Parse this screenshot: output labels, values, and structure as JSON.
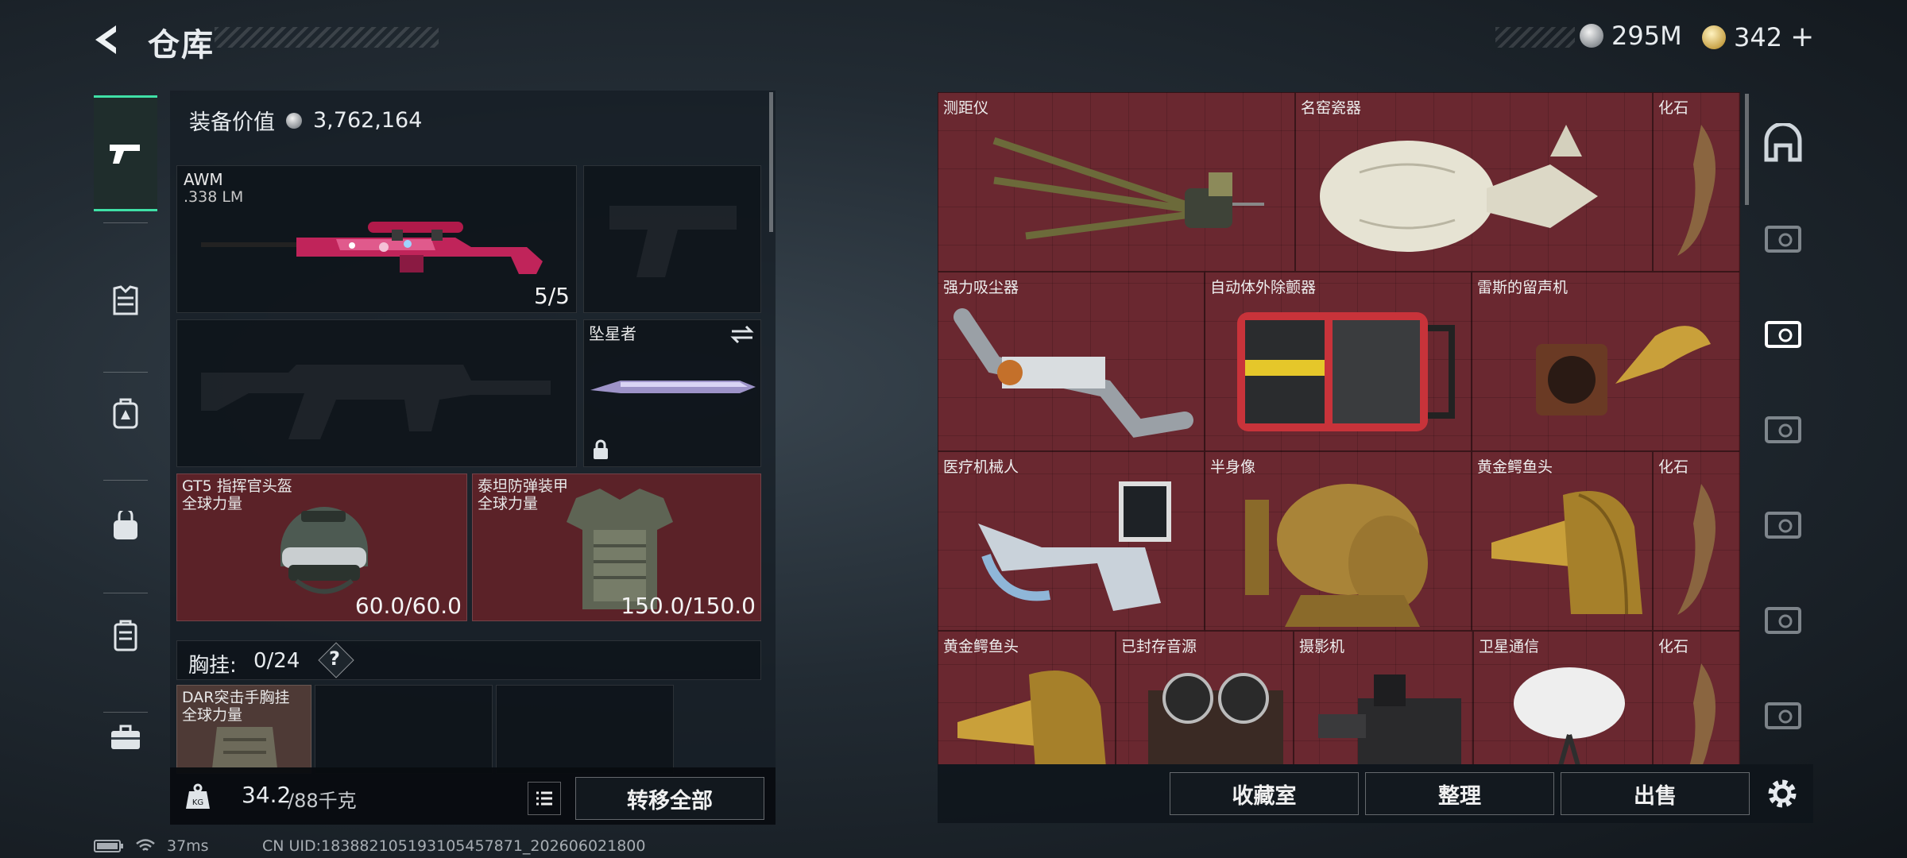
{
  "header": {
    "title": "仓库",
    "silver": "295M",
    "gold": "342",
    "plus": "+"
  },
  "equip": {
    "value_label": "装备价值",
    "value": "3,762,164"
  },
  "primary": {
    "name": "AWM",
    "ammo": ".338 LM",
    "count": "5/5"
  },
  "melee": {
    "name": "坠星者"
  },
  "helmet": {
    "name": "GT5 指挥官头盔",
    "maker": "全球力量",
    "durability": "60.0/60.0"
  },
  "armor": {
    "name": "泰坦防弹装甲",
    "maker": "全球力量",
    "durability": "150.0/150.0"
  },
  "rig": {
    "label": "胸挂:",
    "slots": "0/24",
    "help": "?",
    "item_name": "DAR突击手胸挂",
    "item_maker": "全球力量"
  },
  "weight": {
    "current": "34.2",
    "max": "/88千克",
    "transfer_all": "转移全部"
  },
  "storage": {
    "items": [
      {
        "name": "测距仪"
      },
      {
        "name": "名窑瓷器"
      },
      {
        "name": "化石"
      },
      {
        "name": "强力吸尘器"
      },
      {
        "name": "自动体外除颤器"
      },
      {
        "name": "雷斯的留声机"
      },
      {
        "name": "医疗机械人"
      },
      {
        "name": "半身像"
      },
      {
        "name": "黄金鳄鱼头"
      },
      {
        "name": "化石"
      },
      {
        "name": "黄金鳄鱼头"
      },
      {
        "name": "已封存音源"
      },
      {
        "name": "摄影机"
      },
      {
        "name": "卫星通信"
      },
      {
        "name": "化石"
      }
    ]
  },
  "actions": {
    "collection": "收藏室",
    "sort": "整理",
    "sell": "出售"
  },
  "status": {
    "ping": "37ms",
    "uid": "CN UID:183882105193105457871_202606021800"
  },
  "colors": {
    "accent": "#3fe0a6",
    "slot_red": "#6a2830",
    "panel": "#161e25"
  }
}
